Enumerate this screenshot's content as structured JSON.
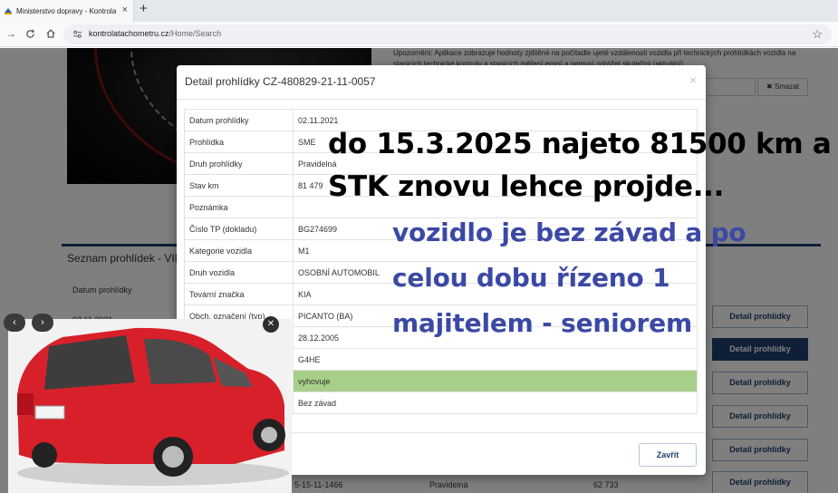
{
  "browser": {
    "tab_title": "Ministerstvo dopravy - Kontrola",
    "tab_close": "×",
    "new_tab": "+",
    "url_host": "kontrolatachometru.cz",
    "url_path": "/Home/Search"
  },
  "background": {
    "intro_text": "Upozornění: Aplikace zobrazuje hodnoty zjištěné na počítadle ujeté vzdálenosti vozidla při technických prohlídkách vozidla na stanicích technické kontroly a stanicích měření emisí a nemusí odrážet skutečný (aktuální)",
    "clear_button": "✖ Smazat",
    "section_title": "Seznam prohlídek - VIN",
    "column_header": "Datum prohlídky",
    "first_row_date": "02.11.2021",
    "detail_button": "Detail prohlídky",
    "bottom_row": {
      "id": "5-15-11-1466",
      "type": "Pravidelná",
      "km": "62 733"
    }
  },
  "modal": {
    "title": "Detail prohlídky CZ-480829-21-11-0057",
    "close_icon": "×",
    "close_button": "Zavřít",
    "rows": [
      {
        "label": "Datum prohlídky",
        "value": "02.11.2021"
      },
      {
        "label": "Prohlídka",
        "value": "SME"
      },
      {
        "label": "Druh prohlídky",
        "value": "Pravidelná"
      },
      {
        "label": "Stav km",
        "value": "81 479"
      },
      {
        "label": "Poznámka",
        "value": ""
      },
      {
        "label": "Číslo TP (dokladu)",
        "value": "BG274699"
      },
      {
        "label": "Kategorie vozidla",
        "value": "M1"
      },
      {
        "label": "Druh vozidla",
        "value": "OSOBNÍ AUTOMOBIL"
      },
      {
        "label": "Tovární značka",
        "value": "KIA"
      },
      {
        "label": "Obch. označení (typ)",
        "value": "PICANTO (BA)"
      },
      {
        "label": "",
        "value": "28.12.2005"
      },
      {
        "label": "",
        "value": "G4HE"
      },
      {
        "label": "",
        "value": "vyhovuje"
      },
      {
        "label": "",
        "value": "Bez závad"
      }
    ]
  },
  "photo": {
    "prev": "‹",
    "next": "›",
    "close": "✕",
    "plate_color": "#f4f4f4",
    "car_color": "#d8202a"
  },
  "captions": {
    "line1": "do 15.3.2025 najeto 81500 km a",
    "line2": "STK znovu lehce projde...",
    "line3": "vozidlo je bez závad a po",
    "line4": "celou dobu řízeno 1",
    "line5": "majitelem - seniorem"
  }
}
